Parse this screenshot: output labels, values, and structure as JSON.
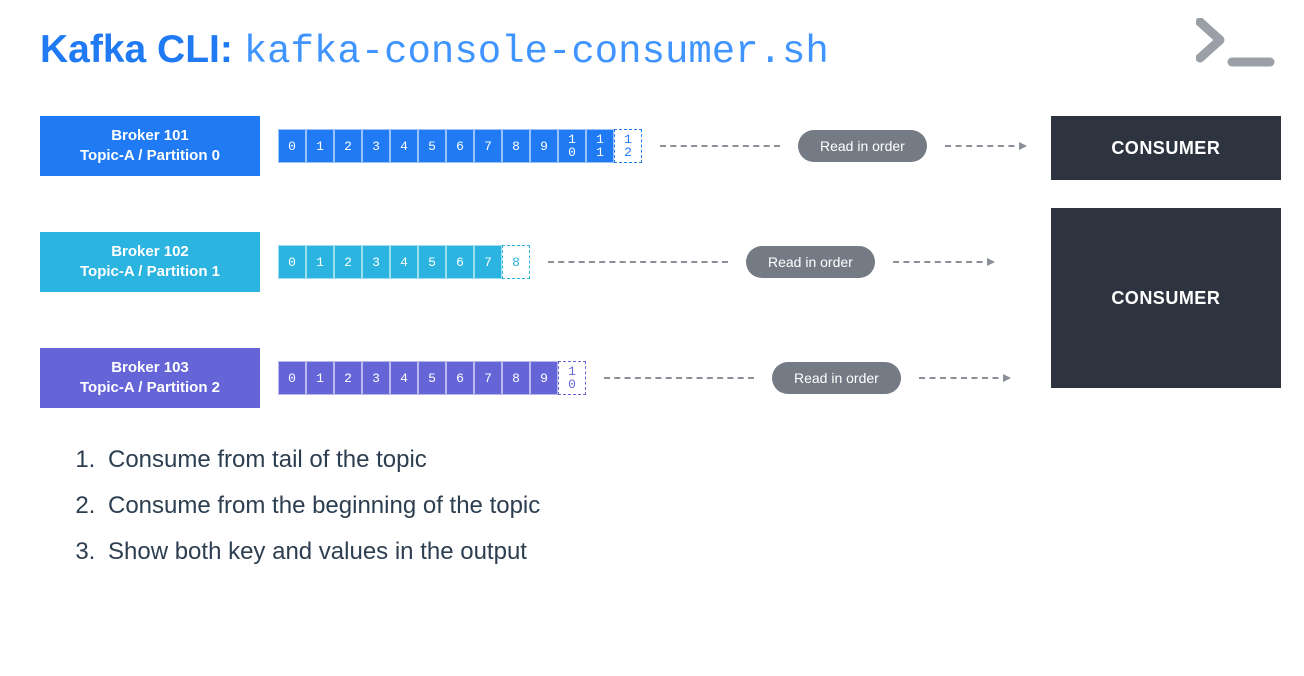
{
  "title_prefix": "Kafka CLI: ",
  "title_cmd": "kafka-console-consumer.sh",
  "brokers": [
    {
      "line1": "Broker 101",
      "line2": "Topic-A / Partition 0",
      "color": "b1",
      "cells": [
        "0",
        "1",
        "2",
        "3",
        "4",
        "5",
        "6",
        "7",
        "8",
        "9",
        "10",
        "11"
      ],
      "pending": [
        "12"
      ],
      "ccol": "c1",
      "pcol": "p1"
    },
    {
      "line1": "Broker 102",
      "line2": "Topic-A / Partition 1",
      "color": "b2",
      "cells": [
        "0",
        "1",
        "2",
        "3",
        "4",
        "5",
        "6",
        "7"
      ],
      "pending": [
        "8"
      ],
      "ccol": "c2",
      "pcol": "p2"
    },
    {
      "line1": "Broker 103",
      "line2": "Topic-A / Partition 2",
      "color": "b3",
      "cells": [
        "0",
        "1",
        "2",
        "3",
        "4",
        "5",
        "6",
        "7",
        "8",
        "9"
      ],
      "pending": [
        "10"
      ],
      "ccol": "c3",
      "pcol": "p3"
    }
  ],
  "read_label": "Read in order",
  "consumer_label": "CONSUMER",
  "bullets": [
    "Consume from tail of the topic",
    "Consume from the beginning of the topic",
    "Show both key and values in the output"
  ]
}
